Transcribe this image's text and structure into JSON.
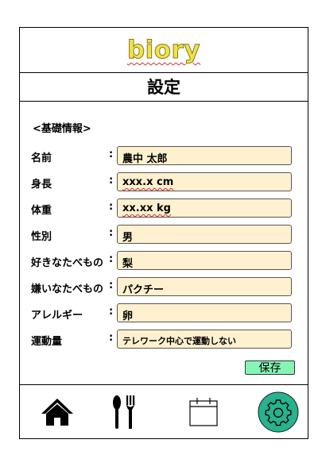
{
  "header": {
    "logo": "biory"
  },
  "page": {
    "title": "設定"
  },
  "section": {
    "label": "<基礎情報>"
  },
  "fields": [
    {
      "label": "名前",
      "colon": ":",
      "value": "農中 太郎"
    },
    {
      "label": "身長",
      "colon": ":",
      "value": "xxx.x cm"
    },
    {
      "label": "体重",
      "colon": ":",
      "value": "xx.xx kg"
    },
    {
      "label": "性別",
      "colon": ":",
      "value": "男"
    },
    {
      "label": "好きなたべもの",
      "colon": ":",
      "value": "梨"
    },
    {
      "label": "嫌いなたべもの",
      "colon": ":",
      "value": "パクチー"
    },
    {
      "label": "アレルギー",
      "colon": ":",
      "value": "卵"
    },
    {
      "label": "運動量",
      "colon": ":",
      "value": "テレワーク中心で運動しない"
    }
  ],
  "actions": {
    "save_label": "保存"
  },
  "nav": {
    "items": [
      {
        "icon": "home-icon"
      },
      {
        "icon": "fork-spoon-icon"
      },
      {
        "icon": "calendar-icon"
      },
      {
        "icon": "gear-icon"
      }
    ],
    "active_color": "#26b38f"
  },
  "colors": {
    "logo": "#efe24d",
    "field_bg": "#fff1cf",
    "save_bg": "#86f5b4"
  }
}
